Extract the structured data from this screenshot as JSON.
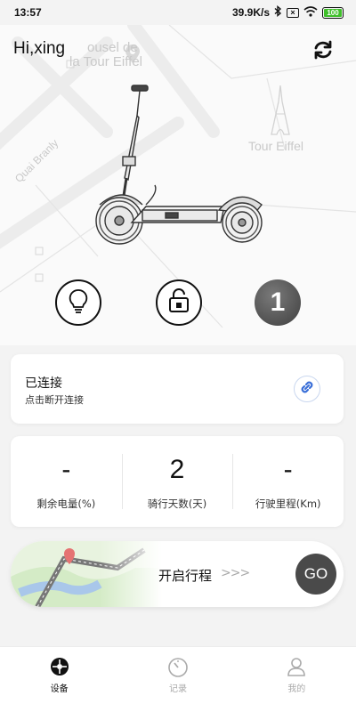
{
  "status_bar": {
    "time": "13:57",
    "network_speed": "39.9K/s",
    "battery_level": "100"
  },
  "header": {
    "greeting": "Hi,xing",
    "refresh_icon": "refresh-icon"
  },
  "map": {
    "labels": [
      "ousel de",
      "la Tour Eiffel",
      "Tour Eiffel",
      "Quai Branly"
    ]
  },
  "controls": {
    "light_icon": "lightbulb-icon",
    "unlock_icon": "unlock-icon",
    "gear_value": "1"
  },
  "connection": {
    "title": "已连接",
    "subtitle": "点击断开连接",
    "icon": "link-icon",
    "icon_color": "#3a6fd8"
  },
  "stats": [
    {
      "value": "-",
      "label": "剩余电量(%)"
    },
    {
      "value": "2",
      "label": "骑行天数(天)"
    },
    {
      "value": "-",
      "label": "行驶里程(Km)"
    }
  ],
  "trip": {
    "label": "开启行程",
    "arrows": ">>>",
    "go_label": "GO"
  },
  "nav": {
    "items": [
      {
        "label": "设备",
        "icon": "device-wheel-icon",
        "active": true
      },
      {
        "label": "记录",
        "icon": "speedometer-icon",
        "active": false
      },
      {
        "label": "我的",
        "icon": "user-icon",
        "active": false
      }
    ]
  }
}
